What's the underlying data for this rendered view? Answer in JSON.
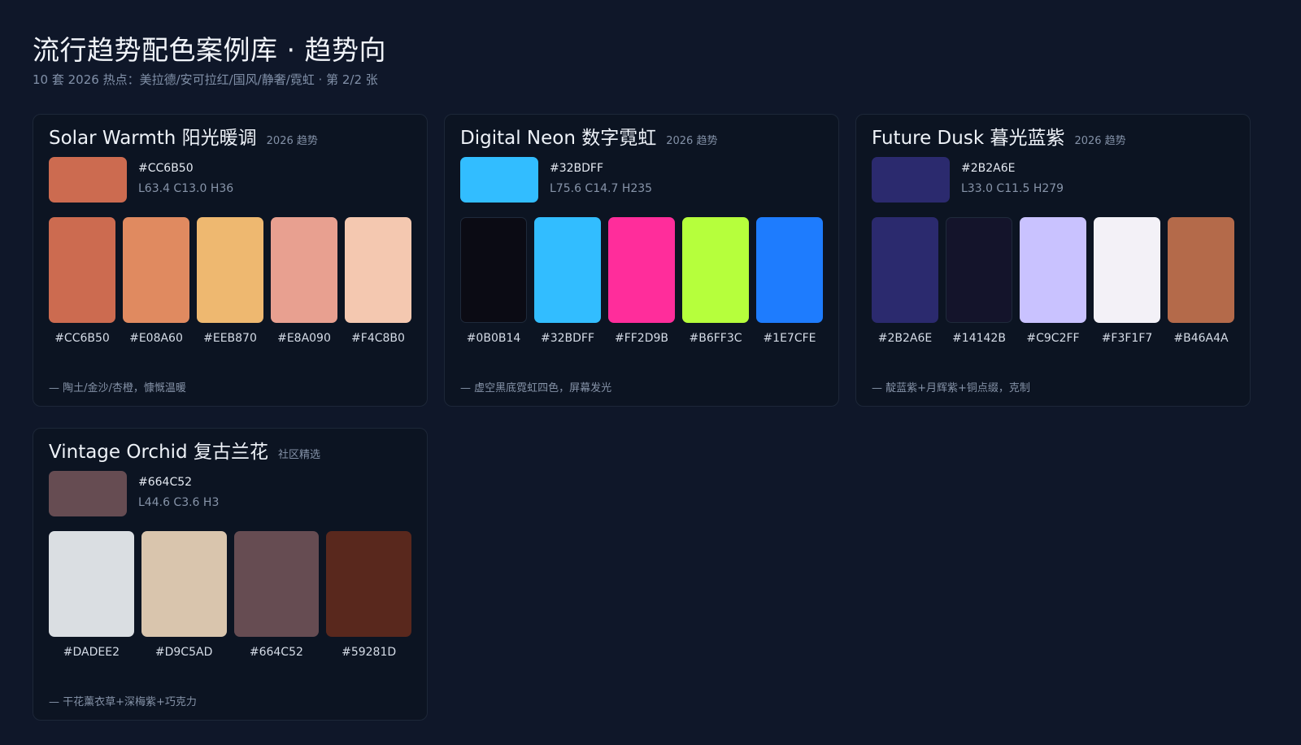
{
  "header": {
    "title": "流行趋势配色案例库 · 趋势向",
    "subtitle": "10 套 2026 热点：美拉德/安可拉红/国风/静奢/霓虹 · 第 2/2 张"
  },
  "cards": [
    {
      "title": "Solar Warmth 阳光暖调",
      "tag": "2026 趋势",
      "primary": {
        "hex": "#CC6B50",
        "lch": "L63.4 C13.0 H36",
        "color": "#cc6b50"
      },
      "swatches": [
        {
          "hex": "#CC6B50",
          "color": "#cc6b50"
        },
        {
          "hex": "#E08A60",
          "color": "#e08a60"
        },
        {
          "hex": "#EEB870",
          "color": "#eeb870"
        },
        {
          "hex": "#E8A090",
          "color": "#e8a090"
        },
        {
          "hex": "#F4C8B0",
          "color": "#f4c8b0"
        }
      ],
      "note": "— 陶土/金沙/杏橙，慷慨温暖"
    },
    {
      "title": "Digital Neon 数字霓虹",
      "tag": "2026 趋势",
      "primary": {
        "hex": "#32BDFF",
        "lch": "L75.6 C14.7 H235",
        "color": "#32bdff"
      },
      "swatches": [
        {
          "hex": "#0B0B14",
          "color": "#0b0b14"
        },
        {
          "hex": "#32BDFF",
          "color": "#32bdff"
        },
        {
          "hex": "#FF2D9B",
          "color": "#ff2d9b"
        },
        {
          "hex": "#B6FF3C",
          "color": "#b6ff3c"
        },
        {
          "hex": "#1E7CFE",
          "color": "#1e7cfe"
        }
      ],
      "note": "— 虚空黑底霓虹四色，屏幕发光"
    },
    {
      "title": "Future Dusk 暮光蓝紫",
      "tag": "2026 趋势",
      "primary": {
        "hex": "#2B2A6E",
        "lch": "L33.0 C11.5 H279",
        "color": "#2b2a6e"
      },
      "swatches": [
        {
          "hex": "#2B2A6E",
          "color": "#2b2a6e"
        },
        {
          "hex": "#14142B",
          "color": "#14142b"
        },
        {
          "hex": "#C9C2FF",
          "color": "#c9c2ff"
        },
        {
          "hex": "#F3F1F7",
          "color": "#f3f1f7"
        },
        {
          "hex": "#B46A4A",
          "color": "#b46a4a"
        }
      ],
      "note": "— 靛蓝紫+月辉紫+铜点缀，克制"
    },
    {
      "title": "Vintage Orchid 复古兰花",
      "tag": "社区精选",
      "primary": {
        "hex": "#664C52",
        "lch": "L44.6 C3.6 H3",
        "color": "#664c52"
      },
      "swatches": [
        {
          "hex": "#DADEE2",
          "color": "#dadee2"
        },
        {
          "hex": "#D9C5AD",
          "color": "#d9c5ad"
        },
        {
          "hex": "#664C52",
          "color": "#664c52"
        },
        {
          "hex": "#59281D",
          "color": "#59281d"
        }
      ],
      "note": "— 干花薰衣草+深梅紫+巧克力"
    }
  ]
}
